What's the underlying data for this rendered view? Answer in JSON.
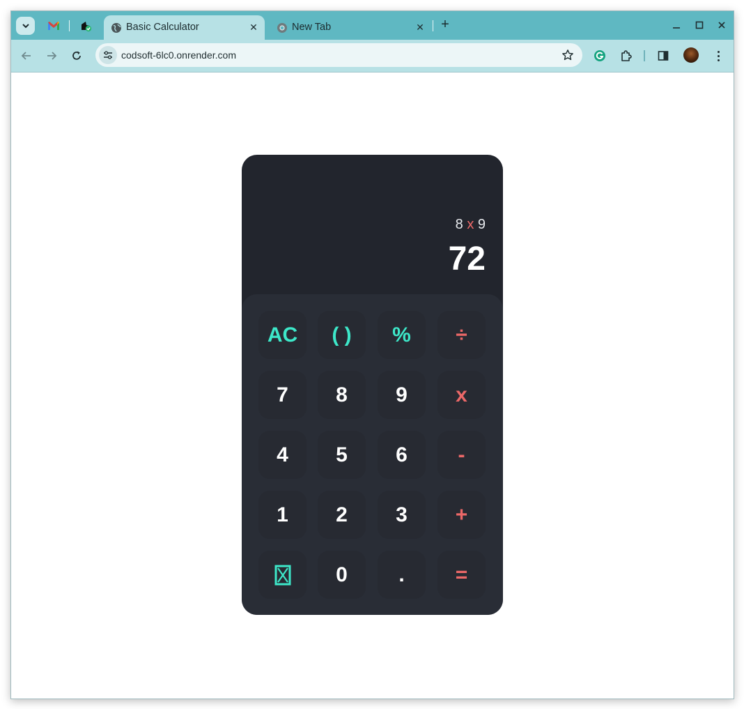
{
  "browser": {
    "tabs": [
      {
        "title": "Basic Calculator",
        "active": true
      },
      {
        "title": "New Tab",
        "active": false
      }
    ],
    "url": "codsoft-6lc0.onrender.com",
    "accent": "#5fb8c2",
    "toolbar_color": "#b7e1e5"
  },
  "calculator": {
    "expression": {
      "left": "8",
      "operator": "x",
      "right": "9"
    },
    "result": "72",
    "colors": {
      "body": "#22252d",
      "keypad": "#292d36",
      "key": "#272a32",
      "function": "#3de8c9",
      "operator": "#ec6868",
      "digit": "#ffffff"
    },
    "keys": [
      {
        "label": "AC",
        "kind": "function"
      },
      {
        "label": "( )",
        "kind": "function"
      },
      {
        "label": "%",
        "kind": "function"
      },
      {
        "label": "÷",
        "kind": "operator"
      },
      {
        "label": "7",
        "kind": "digit"
      },
      {
        "label": "8",
        "kind": "digit"
      },
      {
        "label": "9",
        "kind": "digit"
      },
      {
        "label": "x",
        "kind": "operator"
      },
      {
        "label": "4",
        "kind": "digit"
      },
      {
        "label": "5",
        "kind": "digit"
      },
      {
        "label": "6",
        "kind": "digit"
      },
      {
        "label": "-",
        "kind": "operator"
      },
      {
        "label": "1",
        "kind": "digit"
      },
      {
        "label": "2",
        "kind": "digit"
      },
      {
        "label": "3",
        "kind": "digit"
      },
      {
        "label": "+",
        "kind": "operator"
      },
      {
        "label": "",
        "kind": "function",
        "icon": "backspace-icon"
      },
      {
        "label": "0",
        "kind": "digit"
      },
      {
        "label": ".",
        "kind": "digit"
      },
      {
        "label": "=",
        "kind": "operator"
      }
    ]
  }
}
